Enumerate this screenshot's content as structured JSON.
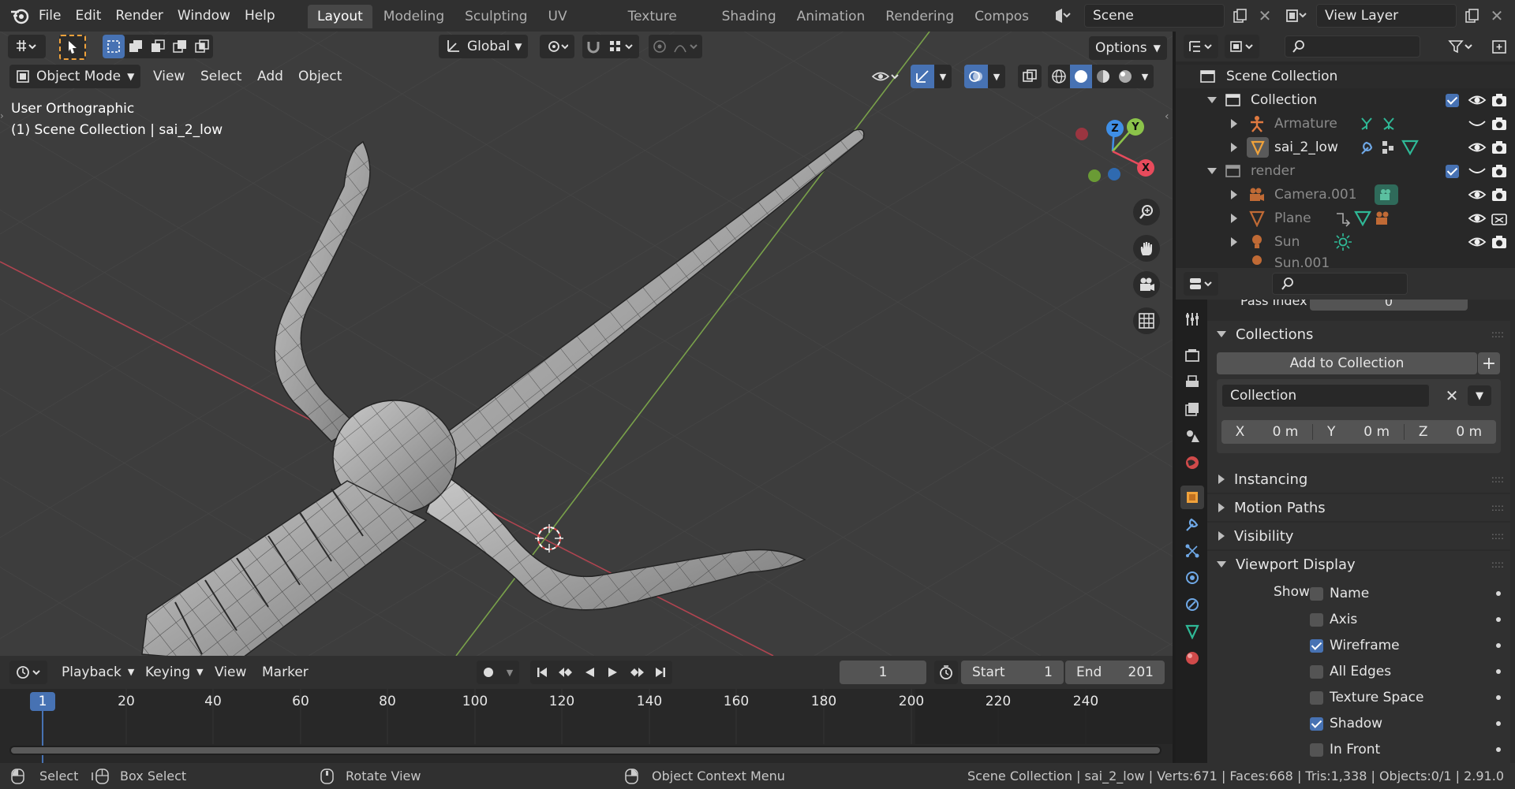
{
  "topbar": {
    "menus": [
      "File",
      "Edit",
      "Render",
      "Window",
      "Help"
    ],
    "workspaces": [
      "Layout",
      "Modeling",
      "Sculpting",
      "UV Editing",
      "Texture Paint",
      "Shading",
      "Animation",
      "Rendering",
      "Compos"
    ],
    "active_workspace": "Layout",
    "scene": "Scene",
    "view_layer": "View Layer"
  },
  "viewport": {
    "transform_orientation": "Global",
    "options_label": "Options",
    "mode": "Object Mode",
    "menus": [
      "View",
      "Select",
      "Add",
      "Object"
    ],
    "view_name": "User Orthographic",
    "view_info": "(1) Scene Collection | sai_2_low",
    "gizmo": {
      "x": "X",
      "y": "Y",
      "z": "Z"
    }
  },
  "outliner": {
    "rows": [
      {
        "label": "Scene Collection",
        "depth": 0
      },
      {
        "label": "Collection",
        "depth": 1
      },
      {
        "label": "Armature",
        "depth": 2
      },
      {
        "label": "sai_2_low",
        "depth": 2
      },
      {
        "label": "render",
        "depth": 1
      },
      {
        "label": "Camera.001",
        "depth": 2
      },
      {
        "label": "Plane",
        "depth": 2
      },
      {
        "label": "Sun",
        "depth": 2
      },
      {
        "label": "Sun.001",
        "depth": 2
      }
    ]
  },
  "properties": {
    "pass_index_label": "Pass Index",
    "pass_index_value": "0",
    "collections_panel": "Collections",
    "add_to_collection": "Add to Collection",
    "collection_name": "Collection",
    "offset": {
      "x_label": "X",
      "x": "0 m",
      "y_label": "Y",
      "y": "0 m",
      "z_label": "Z",
      "z": "0 m"
    },
    "panels": [
      "Instancing",
      "Motion Paths",
      "Visibility",
      "Viewport Display"
    ],
    "show_label": "Show",
    "show_options": [
      {
        "label": "Name",
        "checked": false
      },
      {
        "label": "Axis",
        "checked": false
      },
      {
        "label": "Wireframe",
        "checked": true
      },
      {
        "label": "All Edges",
        "checked": false
      },
      {
        "label": "Texture Space",
        "checked": false
      },
      {
        "label": "Shadow",
        "checked": true
      },
      {
        "label": "In Front",
        "checked": false
      }
    ]
  },
  "timeline": {
    "menus": [
      "Playback",
      "Keying",
      "View",
      "Marker"
    ],
    "current_frame": "1",
    "start_label": "Start",
    "start": "1",
    "end_label": "End",
    "end": "201",
    "ticks": [
      "20",
      "40",
      "60",
      "80",
      "100",
      "120",
      "140",
      "160",
      "180",
      "200",
      "220",
      "240"
    ],
    "playhead": "1"
  },
  "statusbar": {
    "select": "Select",
    "box_select": "Box Select",
    "rotate_view": "Rotate View",
    "context_menu": "Object Context Menu",
    "stats": "Scene Collection | sai_2_low | Verts:671 | Faces:668 | Tris:1,338 | Objects:0/1 | 2.91.0"
  },
  "colors": {
    "accent": "#4772b3",
    "axis_x": "#e84b5c",
    "axis_y": "#8bc34a",
    "axis_z": "#3f8fe6",
    "selected_orange": "#f0a23b"
  }
}
